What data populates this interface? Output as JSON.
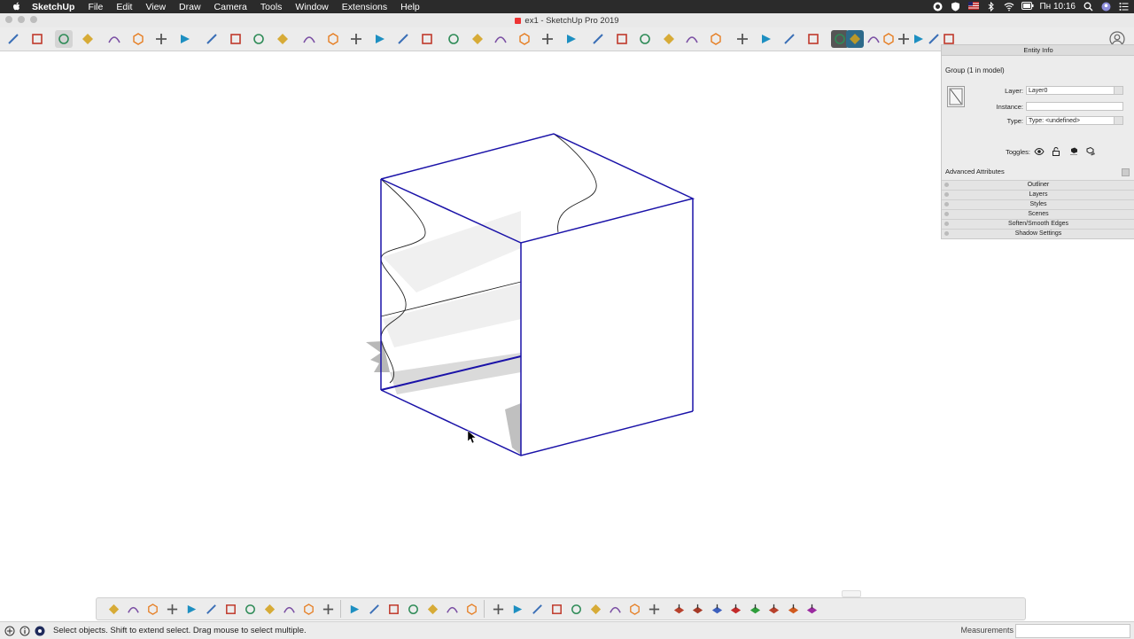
{
  "menubar": {
    "items": [
      "SketchUp",
      "File",
      "Edit",
      "View",
      "Draw",
      "Camera",
      "Tools",
      "Window",
      "Extensions",
      "Help"
    ],
    "clock": "Пн 10:16"
  },
  "window": {
    "title": "ex1 - SketchUp Pro 2019"
  },
  "entity_info": {
    "title": "Entity Info",
    "selection": "Group (1 in model)",
    "layer_label": "Layer:",
    "layer_value": "Layer0",
    "instance_label": "Instance:",
    "instance_value": "",
    "type_label": "Type:",
    "type_value": "Type: <undefined>",
    "toggles_label": "Toggles:",
    "advanced": "Advanced Attributes",
    "trays": [
      "Outliner",
      "Layers",
      "Styles",
      "Scenes",
      "Soften/Smooth Edges",
      "Shadow Settings"
    ]
  },
  "status": {
    "message": "Select objects. Shift to extend select. Drag mouse to select multiple.",
    "measurements_label": "Measurements",
    "measurements_value": ""
  },
  "colors": {
    "edge_selected": "#1a12a8",
    "menubar_bg": "#2b2b2b",
    "toolbar_bg": "#ececec"
  },
  "toolbar_icons": [
    "undo-icon",
    "redo-icon",
    "select-icon",
    "eraser-icon",
    "line-icon",
    "arc-icon",
    "rectangle-icon",
    "push-pull-icon",
    "follow-me-icon",
    "move-icon",
    "rotate-icon",
    "scale-icon",
    "offset-icon",
    "tape-measure-icon",
    "dimension-icon",
    "protractor-icon",
    "text-icon",
    "axes-icon",
    "3d-text-icon",
    "paint-bucket-icon",
    "orbit-icon",
    "pan-icon",
    "zoom-icon",
    "zoom-extents-icon",
    "warehouse-icon",
    "extension-warehouse-icon",
    "layout-icon",
    "ruby-icon",
    "section-plane-icon",
    "display-section-icon",
    "iso-view-icon",
    "top-view-icon",
    "front-view-icon",
    "right-view-icon",
    "back-view-icon",
    "left-view-icon",
    "xray-icon",
    "wireframe-icon",
    "hidden-line-icon",
    "shaded-icon",
    "textured-icon",
    "monochrome-icon"
  ],
  "bottom_toolbar_icons": [
    "sandbox-from-contours-icon",
    "sandbox-from-scratch-icon",
    "smoove-icon",
    "stamp-icon",
    "drape-icon",
    "add-detail-icon",
    "flip-edge-icon",
    "solid-union-icon",
    "solid-intersect-icon",
    "solid-subtract-icon",
    "solid-trim-icon",
    "solid-split-icon",
    "outer-shell-icon",
    "face-icon",
    "cube-icon",
    "box-icon",
    "group-icon",
    "component-icon",
    "curve-icon",
    "bezier-icon",
    "spline-icon",
    "polyline-icon",
    "circle-icon",
    "zigzag-icon",
    "weld-icon",
    "fillet-icon",
    "spiral-icon",
    "render-icon"
  ]
}
